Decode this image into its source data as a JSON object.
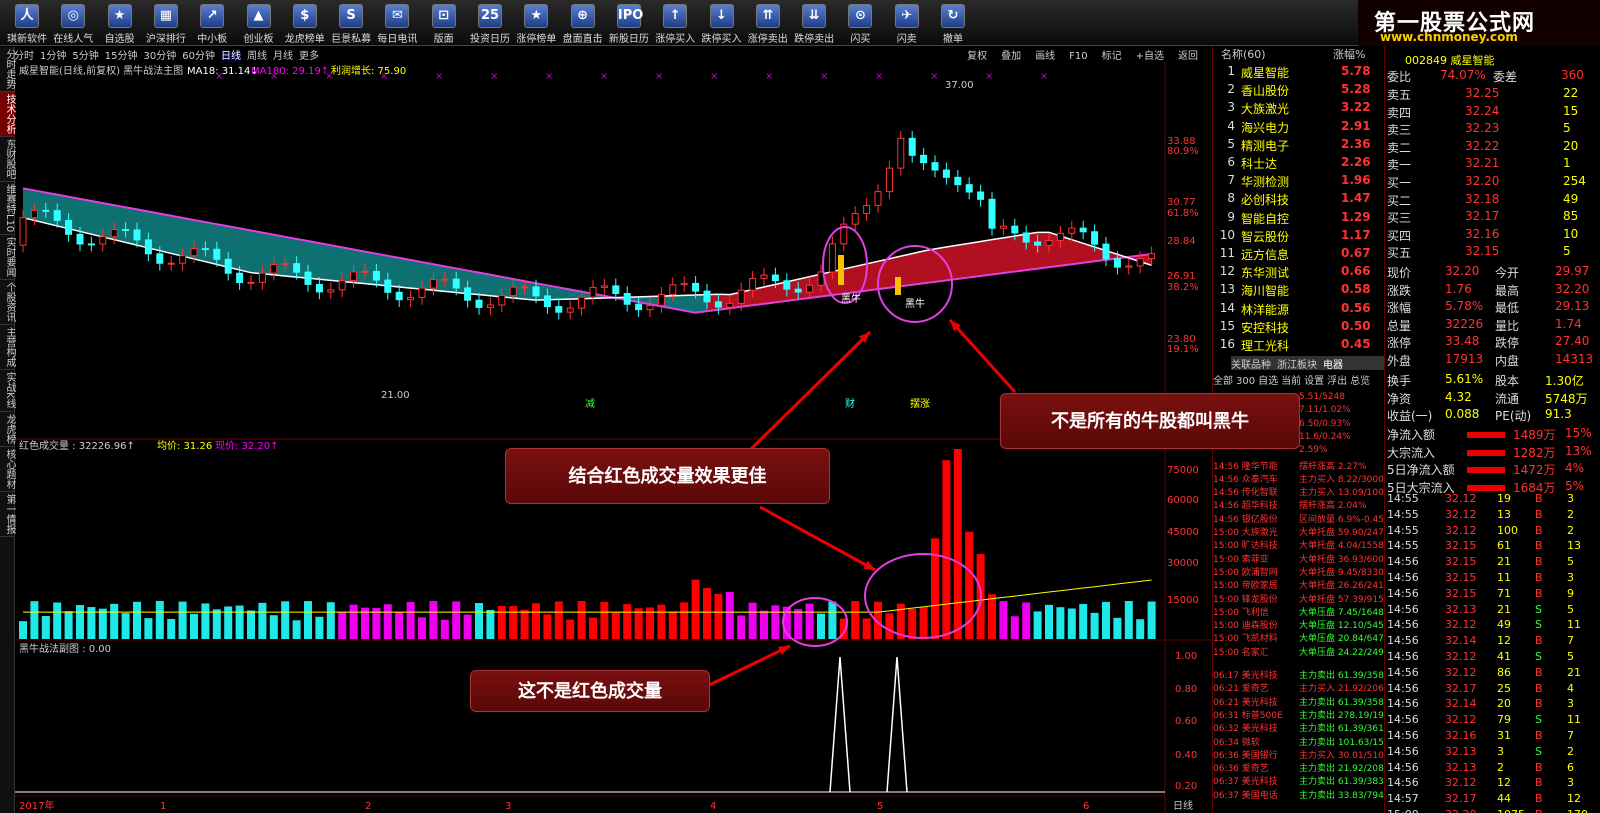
{
  "toolbar": {
    "items": [
      "琪新软件",
      "在线人气",
      "自选股",
      "沪深排行",
      "中小板",
      "创业板",
      "龙虎榜单",
      "巨景私募",
      "每日电讯",
      "版面",
      "投资日历",
      "涨停榜单",
      "盘面直击",
      "新股日历",
      "涨停买入",
      "跌停买入",
      "涨停卖出",
      "跌停卖出",
      "闪买",
      "闪卖",
      "撤单"
    ],
    "icon_glyphs": [
      "人",
      "◎",
      "★",
      "▦",
      "↗",
      "▲",
      "$",
      "S",
      "✉",
      "⊡",
      "25",
      "★",
      "⊕",
      "IPO",
      "↑",
      "↓",
      "⇈",
      "⇊",
      "⊙",
      "✈",
      "↻"
    ]
  },
  "logo": {
    "title": "第一股票公式网",
    "url": "www.chnmoney.com"
  },
  "periods": [
    "分时",
    "1分钟",
    "5分钟",
    "15分钟",
    "30分钟",
    "60分钟",
    "日线",
    "周线",
    "月线",
    "更多"
  ],
  "period_selected": "日线",
  "chart_tools": [
    "复权",
    "叠加",
    "画线",
    "F10",
    "标记",
    "+自选",
    "返回"
  ],
  "leftnav": [
    "分时走势",
    "技术分析",
    "东财股吧",
    "维赛特L10",
    "实时要闻",
    "个股资讯",
    "主营构成",
    "实战K线",
    "龙虎榜",
    "核心题材",
    "第一情报"
  ],
  "main_panel": {
    "stock_title": "威星智能(日线,前复权) 黑牛战法主图",
    "ma18": "MA18: 31.14↓",
    "ma180": "MA180: 29.19↑",
    "profit": "利润增长: 75.90",
    "high_label": "37.00",
    "low_label": "21.00",
    "tags": [
      "减",
      "财",
      "摆涨"
    ],
    "marker1": "黑牛",
    "marker2": "黑牛",
    "y_ticks": [
      "33.88",
      "80.9%",
      "30.77",
      "61.8%",
      "28.84",
      "26.91",
      "38.2%",
      "23.80",
      "19.1%"
    ]
  },
  "volume_panel": {
    "title": "红色成交量 : 32226.96↑",
    "avg": "均价: 31.26",
    "price": "现价: 32.20↑",
    "y_ticks": [
      "75000",
      "60000",
      "45000",
      "30000",
      "15000"
    ]
  },
  "sub_panel": {
    "title": "黑牛战法副图 : 0.00",
    "y_ticks": [
      "1.00",
      "0.80",
      "0.60",
      "0.40",
      "0.20"
    ]
  },
  "x_axis": {
    "labels": [
      "2017年",
      "1",
      "2",
      "3",
      "4",
      "5",
      "6"
    ],
    "right": "日线"
  },
  "callouts": {
    "c1": "结合红色成交量效果更佳",
    "c2": "不是所有的牛股都叫黑牛",
    "c3": "这不是红色成交量"
  },
  "stock_list": {
    "header_name": "名称(60)",
    "header_change": "涨幅%",
    "items": [
      {
        "no": "1",
        "name": "威星智能",
        "chg": "5.78"
      },
      {
        "no": "2",
        "name": "香山股份",
        "chg": "5.28"
      },
      {
        "no": "3",
        "name": "大族激光",
        "chg": "3.22"
      },
      {
        "no": "4",
        "name": "海兴电力",
        "chg": "2.91"
      },
      {
        "no": "5",
        "name": "精测电子",
        "chg": "2.36"
      },
      {
        "no": "6",
        "name": "科士达",
        "chg": "2.26"
      },
      {
        "no": "7",
        "name": "华测检测",
        "chg": "1.96"
      },
      {
        "no": "8",
        "name": "必创科技",
        "chg": "1.47"
      },
      {
        "no": "9",
        "name": "智能自控",
        "chg": "1.29"
      },
      {
        "no": "10",
        "name": "智云股份",
        "chg": "1.17"
      },
      {
        "no": "11",
        "name": "远方信息",
        "chg": "0.67"
      },
      {
        "no": "12",
        "name": "东华测试",
        "chg": "0.66"
      },
      {
        "no": "13",
        "name": "海川智能",
        "chg": "0.58"
      },
      {
        "no": "14",
        "name": "林洋能源",
        "chg": "0.56"
      },
      {
        "no": "15",
        "name": "安控科技",
        "chg": "0.50"
      },
      {
        "no": "16",
        "name": "理工光科",
        "chg": "0.45"
      }
    ],
    "tabs": [
      "关联品种",
      "浙江板块",
      "电器"
    ],
    "subtabs": [
      "全部",
      "300",
      "自选",
      "当前",
      "设置",
      "浮出",
      "总览"
    ]
  },
  "news": [
    [
      "",
      "5.51/5248"
    ],
    [
      "",
      "7.11/1.02%"
    ],
    [
      "",
      "6.50/0.93%"
    ],
    [
      "",
      "11.6/0.24%"
    ],
    [
      "",
      "2.59%"
    ],
    [
      "14:56 隆华节能",
      "摆杆涨高 2.27%"
    ],
    [
      "14:56 众泰汽车",
      "主力买入 8.22/30000"
    ],
    [
      "14:56 传化智联",
      "主力买入 13.09/10000"
    ],
    [
      "14:56 超华科技",
      "摆杆涨高 2.04%"
    ],
    [
      "14:56 银亿股份",
      "区间放量 6.9%-0.45%"
    ],
    [
      "15:00 大族激光",
      "大单托盘 59.90/2477"
    ],
    [
      "15:00 旷达科技",
      "大单托盘 4.04/15585"
    ],
    [
      "15:00 索菲亚",
      "大单托盘 36.93/6006"
    ],
    [
      "15:00 欧浦智网",
      "大单托盘 9.45/8330"
    ],
    [
      "15:00 帝欧家居",
      "大单托盘 26.26/2411"
    ],
    [
      "15:00 锋龙股份",
      "大单托盘 57.39/915"
    ],
    [
      "15:00 飞利信",
      "大单压盘 7.45/16488"
    ],
    [
      "15:00 迪森股份",
      "大单压盘 12.10/5454"
    ],
    [
      "15:00 飞凯材料",
      "大单压盘 20.84/6478"
    ],
    [
      "15:00 名家汇",
      "大单压盘 24.22/2491"
    ]
  ],
  "news2": [
    [
      "06:17 美光科技",
      "主力卖出 61.39/35843"
    ],
    [
      "06:21 爱奇艺",
      "主力买入 21.92/20682"
    ],
    [
      "06:21 美光科技",
      "主力卖出 61.39/35843"
    ],
    [
      "06:31 标普500E",
      "主力卖出 278.19/19120"
    ],
    [
      "06:32 美光科技",
      "主力卖出 61.39/36159"
    ],
    [
      "06:34 微软",
      "主力卖出 101.63/15776"
    ],
    [
      "06:36 美国银行",
      "主力买入 30.01/51008"
    ],
    [
      "06:36 爱奇艺",
      "主力卖出 21.92/20844"
    ],
    [
      "06:37 美光科技",
      "主力卖出 61.39/38311"
    ],
    [
      "06:37 美国电话",
      "主力卖出 33.83/79448"
    ]
  ],
  "quote": {
    "header": "002849 威星智能",
    "webi": [
      "委比",
      "74.07%",
      "委差",
      "360"
    ],
    "sell": [
      [
        "卖五",
        "32.25",
        "22"
      ],
      [
        "卖四",
        "32.24",
        "15"
      ],
      [
        "卖三",
        "32.23",
        "5"
      ],
      [
        "卖二",
        "32.22",
        "20"
      ],
      [
        "卖一",
        "32.21",
        "1"
      ]
    ],
    "buy": [
      [
        "买一",
        "32.20",
        "254"
      ],
      [
        "买二",
        "32.18",
        "49"
      ],
      [
        "买三",
        "32.17",
        "85"
      ],
      [
        "买四",
        "32.16",
        "10"
      ],
      [
        "买五",
        "32.15",
        "5"
      ]
    ],
    "stats": [
      [
        "现价",
        "32.20",
        "今开",
        "29.97"
      ],
      [
        "涨跌",
        "1.76",
        "最高",
        "32.20"
      ],
      [
        "涨幅",
        "5.78%",
        "最低",
        "29.13"
      ],
      [
        "总量",
        "32226",
        "量比",
        "1.74"
      ],
      [
        "涨停",
        "33.48",
        "跌停",
        "27.40"
      ],
      [
        "外盘",
        "17913",
        "内盘",
        "14313"
      ]
    ],
    "stats2": [
      [
        "换手",
        "5.61%",
        "股本",
        "1.30亿"
      ],
      [
        "净资",
        "4.32",
        "流通",
        "5748万"
      ],
      [
        "收益(一)",
        "0.088",
        "PE(动)",
        "91.3"
      ]
    ],
    "flows": [
      [
        "净流入额",
        "1489万",
        "15%"
      ],
      [
        "大宗流入",
        "1282万",
        "13%"
      ],
      [
        "5日净流入额",
        "1472万",
        "4%"
      ],
      [
        "5日大宗流入",
        "1684万",
        "5%"
      ]
    ],
    "ticks": [
      [
        "14:55",
        "32.12",
        "19",
        "B",
        "3"
      ],
      [
        "14:55",
        "32.12",
        "13",
        "B",
        "2"
      ],
      [
        "14:55",
        "32.12",
        "100",
        "B",
        "2"
      ],
      [
        "14:55",
        "32.15",
        "61",
        "B",
        "13"
      ],
      [
        "14:56",
        "32.15",
        "21",
        "B",
        "5"
      ],
      [
        "14:56",
        "32.15",
        "11",
        "B",
        "3"
      ],
      [
        "14:56",
        "32.15",
        "71",
        "B",
        "9"
      ],
      [
        "14:56",
        "32.13",
        "21",
        "S",
        "5"
      ],
      [
        "14:56",
        "32.12",
        "49",
        "S",
        "11"
      ],
      [
        "14:56",
        "32.14",
        "12",
        "B",
        "7"
      ],
      [
        "14:56",
        "32.12",
        "41",
        "S",
        "5"
      ],
      [
        "14:56",
        "32.12",
        "86",
        "B",
        "21"
      ],
      [
        "14:56",
        "32.17",
        "25",
        "B",
        "4"
      ],
      [
        "14:56",
        "32.14",
        "20",
        "B",
        "3"
      ],
      [
        "14:56",
        "32.12",
        "79",
        "S",
        "11"
      ],
      [
        "14:56",
        "32.16",
        "31",
        "B",
        "7"
      ],
      [
        "14:56",
        "32.13",
        "3",
        "S",
        "2"
      ],
      [
        "14:56",
        "32.13",
        "2",
        "B",
        "6"
      ],
      [
        "14:56",
        "32.12",
        "12",
        "B",
        "3"
      ],
      [
        "14:57",
        "32.17",
        "44",
        "B",
        "12"
      ],
      [
        "15:00",
        "32.20",
        "1075",
        "B",
        "170"
      ]
    ]
  }
}
